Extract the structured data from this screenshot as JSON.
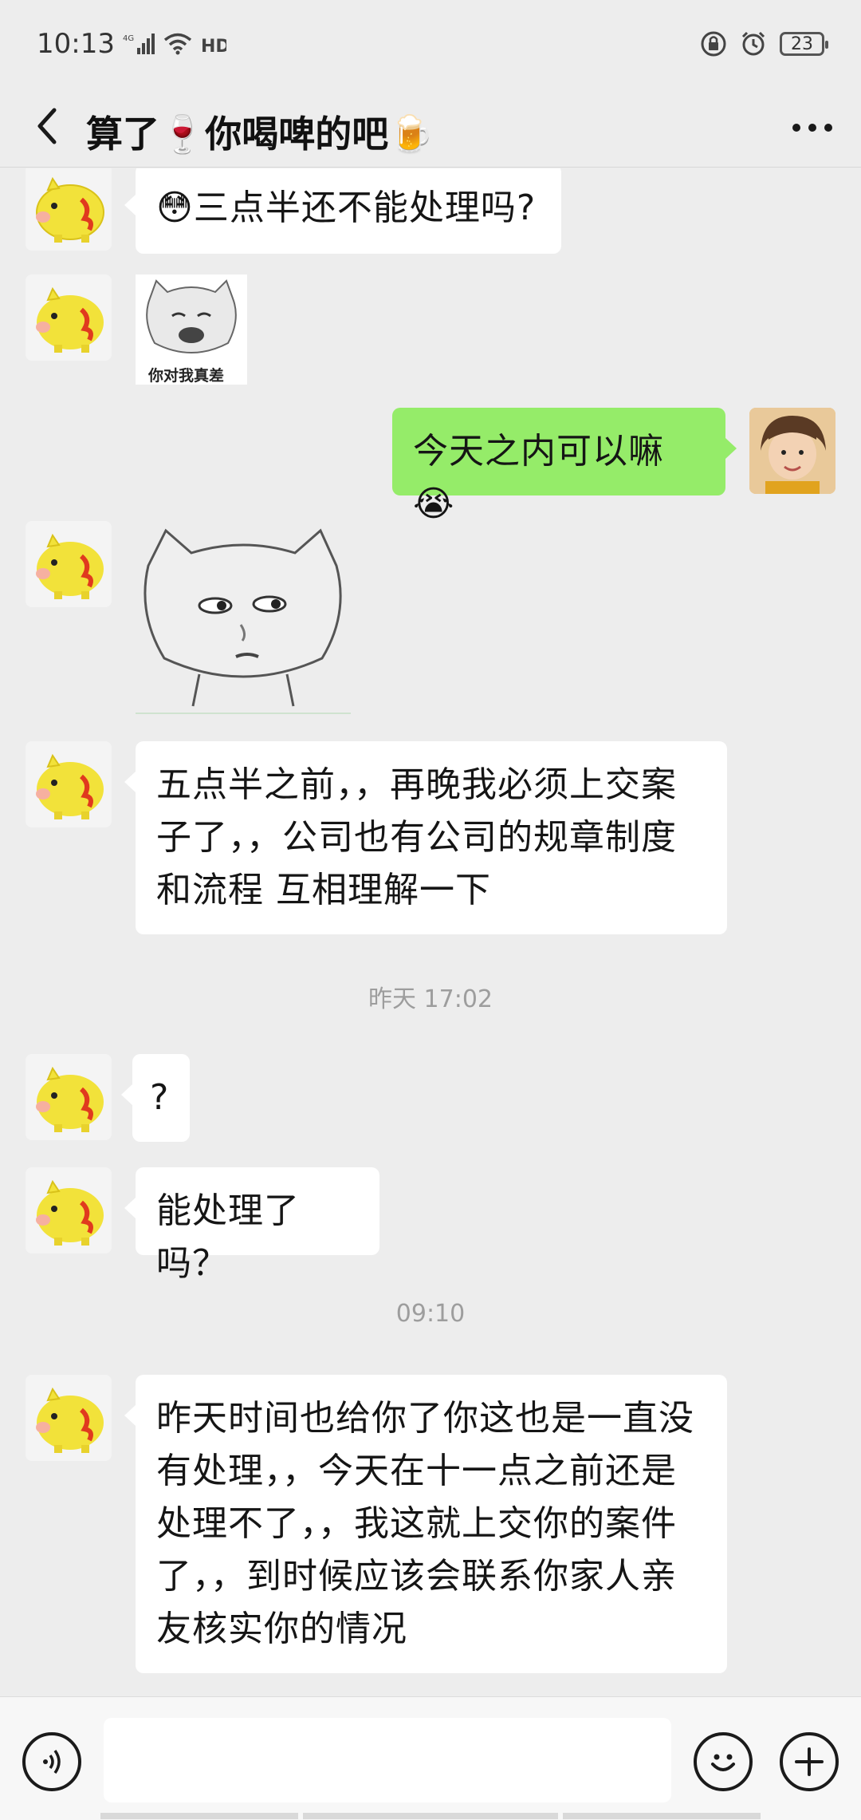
{
  "status_bar": {
    "time": "10:13",
    "network_label": "4G",
    "hd_label": "HD",
    "battery_level": "23"
  },
  "header": {
    "title": "算了🍷你喝啤的吧🍺"
  },
  "messages": [
    {
      "side": "left",
      "type": "text",
      "text": "😳三点半还不能处理吗?"
    },
    {
      "side": "left",
      "type": "sticker",
      "caption": "你对我真差"
    },
    {
      "side": "right",
      "type": "text",
      "text": "今天之内可以嘛😭"
    },
    {
      "side": "left",
      "type": "sticker",
      "caption": ""
    },
    {
      "side": "left",
      "type": "text",
      "text": "五点半之前，，再晚我必须上交案子了，，公司也有公司的规章制度和流程  互相理解一下"
    },
    {
      "side": "left",
      "type": "text",
      "text": "?"
    },
    {
      "side": "left",
      "type": "text",
      "text": "能处理了吗？"
    },
    {
      "side": "left",
      "type": "text",
      "text": "昨天时间也给你了你这也是一直没有处理，，今天在十一点之前还是处理不了，，我这就上交你的案件了，，到时候应该会联系你家人亲友核实你的情况"
    }
  ],
  "timestamps": [
    "昨天 17:02",
    "09:10"
  ],
  "input": {
    "value": "",
    "placeholder": ""
  },
  "icons": {
    "back": "back-arrow-icon",
    "more": "more-dots-icon",
    "voice": "voice-icon",
    "emoji": "emoji-icon",
    "plus": "plus-icon"
  },
  "colors": {
    "background": "#ededed",
    "sent_bubble": "#95ec69",
    "received_bubble": "#ffffff",
    "timestamp_text": "#9d9d9d"
  }
}
